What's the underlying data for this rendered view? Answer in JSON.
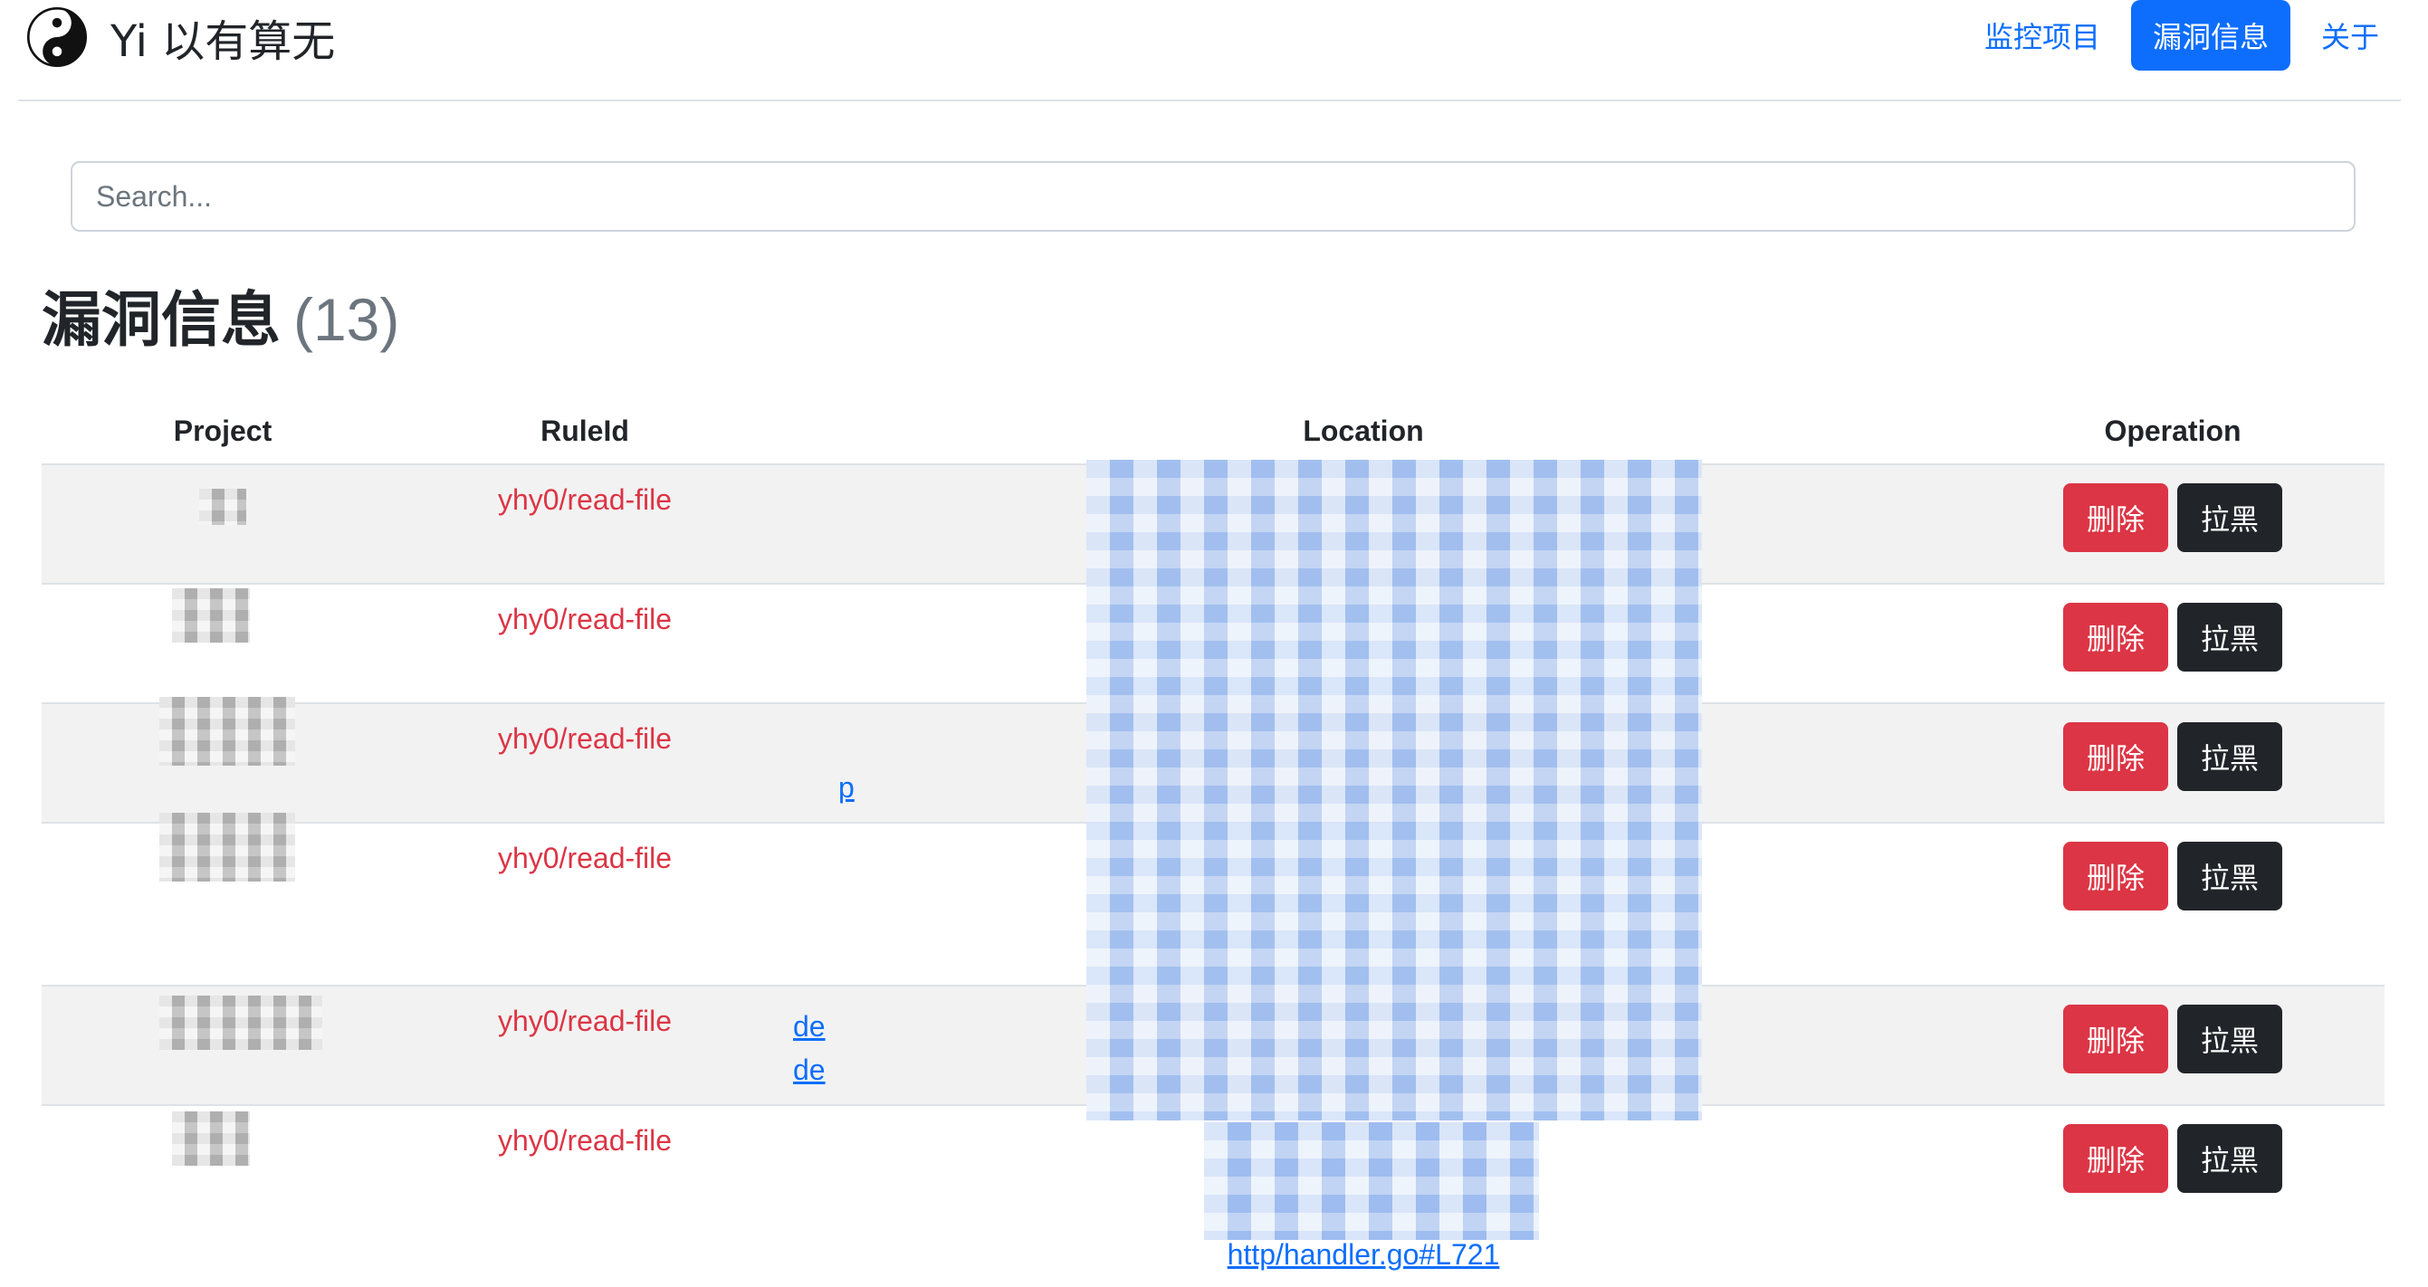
{
  "app": {
    "brand_title": "Yi 以有算无",
    "brand_icon": "yin-yang-icon"
  },
  "nav": {
    "items": [
      {
        "label": "监控项目",
        "active": false
      },
      {
        "label": "漏洞信息",
        "active": true
      },
      {
        "label": "关于",
        "active": false
      }
    ]
  },
  "search": {
    "placeholder": "Search...",
    "value": ""
  },
  "heading": {
    "title": "漏洞信息",
    "count": "(13)"
  },
  "table": {
    "columns": [
      "Project",
      "RuleId",
      "Location",
      "Operation"
    ],
    "rows": [
      {
        "project": "",
        "rule_id": "yhy0/read-file",
        "locations": [],
        "delete_label": "删除",
        "block_label": "拉黑"
      },
      {
        "project": "",
        "rule_id": "yhy0/read-file",
        "locations": [],
        "delete_label": "删除",
        "block_label": "拉黑"
      },
      {
        "project": "s",
        "rule_id": "yhy0/read-file",
        "locations": [
          "p"
        ],
        "delete_label": "删除",
        "block_label": "拉黑"
      },
      {
        "project": "D",
        "rule_id": "yhy0/read-file",
        "locations": [],
        "delete_label": "删除",
        "block_label": "拉黑"
      },
      {
        "project": "Th",
        "rule_id": "yhy0/read-file",
        "locations": [
          "de",
          "de"
        ],
        "delete_label": "删除",
        "block_label": "拉黑"
      },
      {
        "project": "",
        "rule_id": "yhy0/read-file",
        "locations": [
          "http/handler.go#L721"
        ],
        "delete_label": "删除",
        "block_label": "拉黑"
      }
    ]
  },
  "colors": {
    "primary": "#0d6efd",
    "danger": "#dc3545",
    "dark": "#212529",
    "stripe": "#f2f2f2",
    "muted": "#6c757d"
  }
}
